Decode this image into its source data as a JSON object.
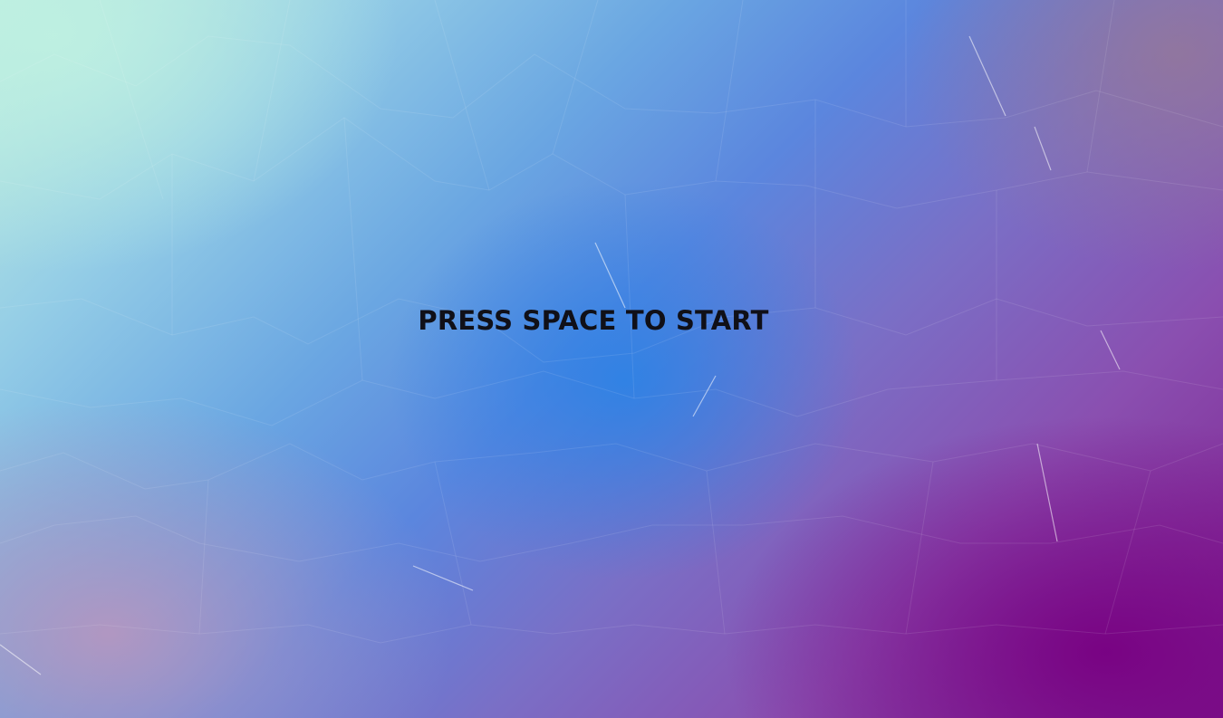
{
  "screen": {
    "prompt_text": "PRESS SPACE TO START"
  },
  "background": {
    "style": "low-poly-gradient",
    "colors": {
      "top_left": "#bfeee0",
      "center": "#2f86e0",
      "top_right": "#9a7f9f",
      "bottom_left": "#b896c0",
      "bottom_right": "#7a0478"
    }
  }
}
